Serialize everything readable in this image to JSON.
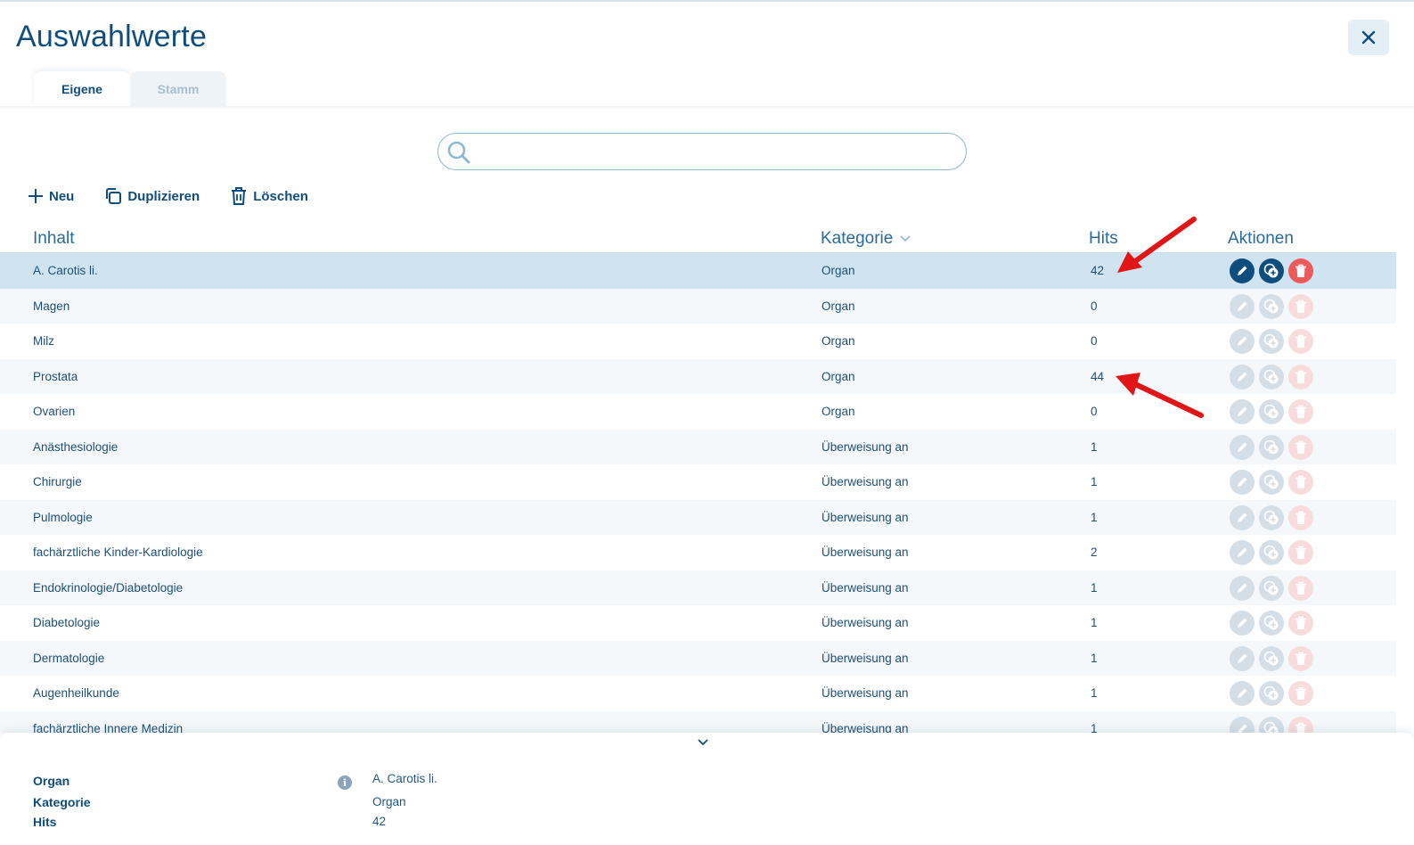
{
  "window": {
    "title": "Auswahlwerte"
  },
  "tabs": [
    {
      "label": "Eigene",
      "active": true
    },
    {
      "label": "Stamm",
      "active": false
    }
  ],
  "search": {
    "value": "",
    "placeholder": ""
  },
  "toolbar": {
    "new_label": "Neu",
    "duplicate_label": "Duplizieren",
    "delete_label": "Löschen"
  },
  "table": {
    "headers": {
      "inhalt": "Inhalt",
      "kategorie": "Kategorie",
      "hits": "Hits",
      "aktionen": "Aktionen"
    },
    "rows": [
      {
        "inhalt": "A. Carotis li.",
        "kategorie": "Organ",
        "hits": "42",
        "selected": true
      },
      {
        "inhalt": "Magen",
        "kategorie": "Organ",
        "hits": "0"
      },
      {
        "inhalt": "Milz",
        "kategorie": "Organ",
        "hits": "0"
      },
      {
        "inhalt": "Prostata",
        "kategorie": "Organ",
        "hits": "44"
      },
      {
        "inhalt": "Ovarien",
        "kategorie": "Organ",
        "hits": "0"
      },
      {
        "inhalt": "Anästhesiologie",
        "kategorie": "Überweisung an",
        "hits": "1"
      },
      {
        "inhalt": "Chirurgie",
        "kategorie": "Überweisung an",
        "hits": "1"
      },
      {
        "inhalt": "Pulmologie",
        "kategorie": "Überweisung an",
        "hits": "1"
      },
      {
        "inhalt": "fachärztliche Kinder-Kardiologie",
        "kategorie": "Überweisung an",
        "hits": "2"
      },
      {
        "inhalt": "Endokrinologie/Diabetologie",
        "kategorie": "Überweisung an",
        "hits": "1"
      },
      {
        "inhalt": "Diabetologie",
        "kategorie": "Überweisung an",
        "hits": "1"
      },
      {
        "inhalt": "Dermatologie",
        "kategorie": "Überweisung an",
        "hits": "1"
      },
      {
        "inhalt": "Augenheilkunde",
        "kategorie": "Überweisung an",
        "hits": "1"
      },
      {
        "inhalt": "fachärztliche Innere Medizin",
        "kategorie": "Überweisung an",
        "hits": "1"
      }
    ]
  },
  "detail": {
    "labels": {
      "organ": "Organ",
      "kategorie": "Kategorie",
      "hits": "Hits"
    },
    "values": {
      "organ": "A. Carotis li.",
      "kategorie": "Organ",
      "hits": "42"
    }
  },
  "icons": {
    "close": "close-icon",
    "search": "search-icon",
    "new": "plus-icon",
    "duplicate": "copy-icon",
    "delete": "trash-icon",
    "sort": "chevron-down-icon",
    "edit": "pencil-icon",
    "row_duplicate": "duplicate-icon",
    "row_delete": "trash-icon",
    "info": "info-icon",
    "toggle": "chevron-down-icon",
    "annotation": "red-arrow-icon"
  },
  "colors": {
    "brand": "#0e4d7d",
    "selected_row": "#cfe4f0",
    "alt_row": "#f4f8fa",
    "delete": "#ee5a5a",
    "annotation": "#e01515"
  }
}
